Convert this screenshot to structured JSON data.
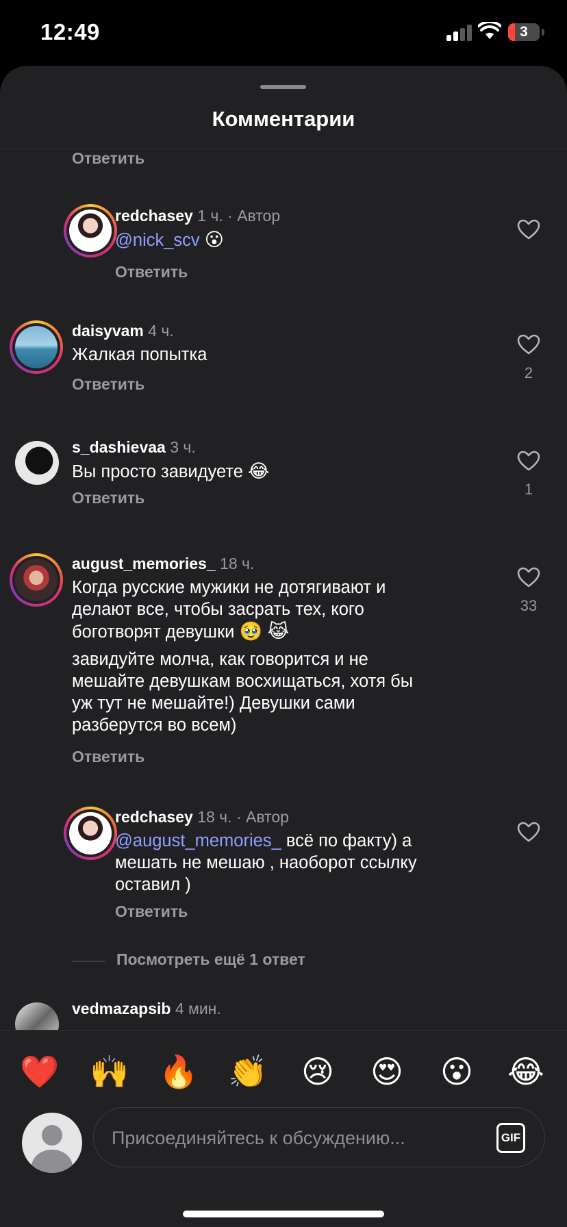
{
  "status": {
    "time": "12:49",
    "battery": "3",
    "icons": [
      "cellular-signal-icon",
      "wifi-icon",
      "battery-icon"
    ]
  },
  "sheet": {
    "title": "Комментарии"
  },
  "top_reply": "Ответить",
  "comments": [
    {
      "username": "redchasey",
      "time": "1 ч.",
      "author_tag": "· Автор",
      "mention": "@nick_scv",
      "text": "",
      "emoji": "😮",
      "reply": "Ответить",
      "likes": "",
      "is_reply": true
    },
    {
      "username": "daisyvam",
      "time": "4 ч.",
      "text": "Жалкая попытка",
      "reply": "Ответить",
      "likes": "2"
    },
    {
      "username": "s_dashievaa",
      "time": "3 ч.",
      "text": "Вы просто завидуете",
      "emoji": "😂",
      "reply": "Ответить",
      "likes": "1"
    },
    {
      "username": "august_memories_",
      "time": "18 ч.",
      "lines": [
        "Когда русские мужики не дотягивают и",
        "делают все, чтобы засрать тех, кого",
        "боготворят девушки"
      ],
      "emoji": "🥹 😹",
      "lines2": [
        "завидуйте молча, как говорится и не",
        "мешайте девушкам восхищаться, хотя  бы",
        "уж тут не мешайте!) Девушки сами",
        "разберутся во всем)"
      ],
      "reply": "Ответить",
      "likes": "33"
    },
    {
      "username": "redchasey",
      "time": "18 ч.",
      "author_tag": "· Автор",
      "mention": "@august_memories_",
      "text": " всё по факту) а",
      "lines": [
        "мешать не мешаю , наоборот ссылку",
        "оставил )"
      ],
      "reply": "Ответить",
      "likes": "",
      "is_reply": true
    },
    {
      "username": "vedmazapsib",
      "time": "4 мин."
    }
  ],
  "view_more": "Посмотреть ещё 1 ответ",
  "emoji_bar": [
    "❤️",
    "🙌",
    "🔥",
    "👏",
    "😢",
    "😍",
    "😮",
    "😂"
  ],
  "composer": {
    "placeholder": "Присоединяйтесь к обсуждению...",
    "gif_label": "GIF"
  }
}
